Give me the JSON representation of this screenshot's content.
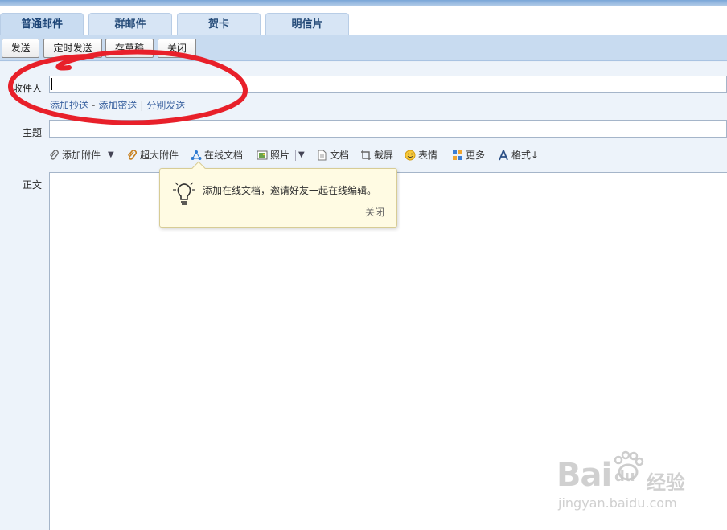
{
  "tabs": [
    "普通邮件",
    "群邮件",
    "贺卡",
    "明信片"
  ],
  "toolbar": {
    "send": "发送",
    "scheduled_send": "定时发送",
    "save_draft": "存草稿",
    "close": "关闭"
  },
  "form": {
    "recipient_label": "收件人",
    "recipient_value": "",
    "add_cc": "添加抄送",
    "dash": "-",
    "add_bcc": "添加密送",
    "pipe": "|",
    "separate_send": "分别发送",
    "subject_label": "主题",
    "subject_value": "",
    "body_label": "正文"
  },
  "tools": {
    "attachment": "添加附件",
    "large_attachment": "超大附件",
    "online_doc": "在线文档",
    "photo": "照片",
    "document": "文档",
    "screenshot": "截屏",
    "emoji": "表情",
    "more": "更多",
    "format": "格式",
    "format_suffix": "↓",
    "dropdown": "▼",
    "divider": "|"
  },
  "tooltip": {
    "text": "添加在线文档，邀请好友一起在线编辑。",
    "close": "关闭"
  },
  "watermark": {
    "brand": "Bai",
    "brand2": "du",
    "cn": "经验",
    "url": "jingyan.baidu.com"
  },
  "colors": {
    "annotation_red": "#e8202a",
    "tab_text": "#274d7a",
    "link": "#3a62a0"
  },
  "icons": [
    "paperclip-icon",
    "large-clip-icon",
    "online-doc-icon",
    "photo-icon",
    "document-icon",
    "screenshot-icon",
    "smiley-icon",
    "more-icon",
    "format-icon",
    "lightbulb-icon"
  ]
}
